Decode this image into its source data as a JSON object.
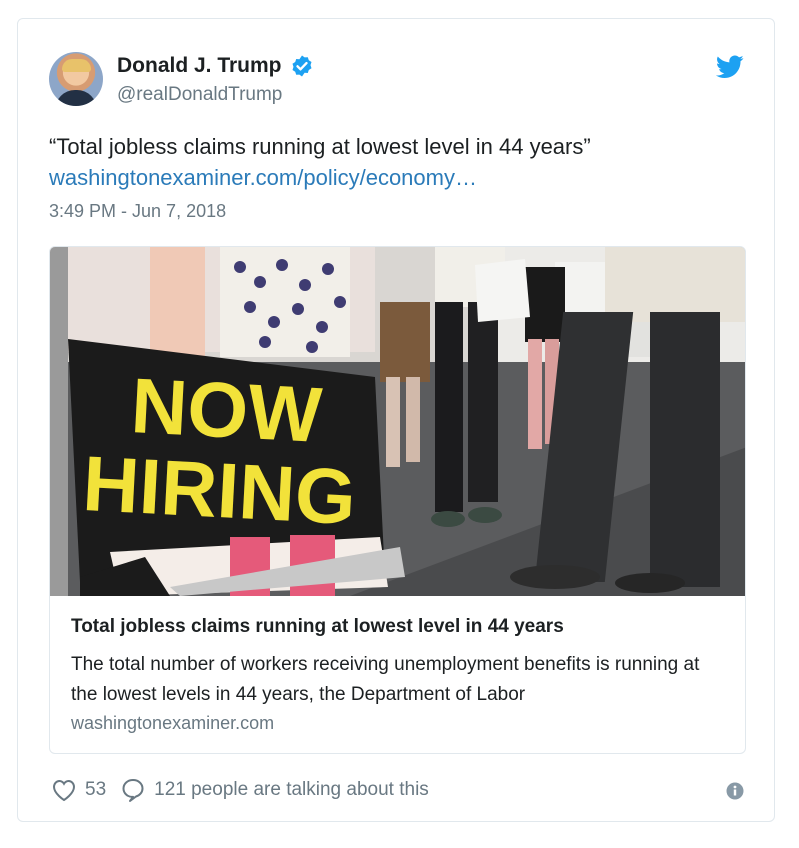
{
  "author": {
    "display_name": "Donald J. Trump",
    "handle": "@realDonaldTrump",
    "verified_icon": "verified-badge-icon"
  },
  "tweet": {
    "text": "“Total jobless claims running at lowest level in 44 years”",
    "link": "washingtonexaminer.com/policy/economy…",
    "timestamp": "3:49 PM - Jun 7, 2018"
  },
  "card": {
    "image_sign_line1": "NOW",
    "image_sign_line2": "HIRING",
    "title": "Total jobless claims running at lowest level in 44 years",
    "description": "The total number of workers receiving unemployment benefits is running at the lowest levels in 44 years, the Department of Labor",
    "domain": "washingtonexaminer.com"
  },
  "footer": {
    "like_count": "53",
    "talk_text": "121 people are talking about this"
  },
  "colors": {
    "accent": "#1da1f2",
    "link": "#2b7bb9",
    "muted": "#697882",
    "sign_yellow": "#f2e23a"
  }
}
